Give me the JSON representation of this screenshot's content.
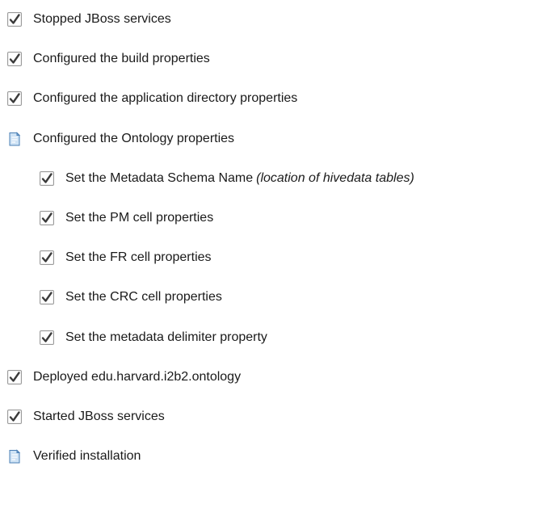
{
  "checklist": [
    {
      "level": 0,
      "status": "done",
      "icon": "checked-checkbox-icon",
      "label": "Stopped JBoss services",
      "note": ""
    },
    {
      "level": 0,
      "status": "done",
      "icon": "checked-checkbox-icon",
      "label": "Configured the build properties",
      "note": ""
    },
    {
      "level": 0,
      "status": "done",
      "icon": "checked-checkbox-icon",
      "label": "Configured the application directory properties",
      "note": ""
    },
    {
      "level": 0,
      "status": "pending",
      "icon": "document-icon",
      "label": "Configured the Ontology properties",
      "note": ""
    },
    {
      "level": 1,
      "status": "done",
      "icon": "checked-checkbox-icon",
      "label": "Set the Metadata Schema Name",
      "note": "(location of hivedata tables)"
    },
    {
      "level": 1,
      "status": "done",
      "icon": "checked-checkbox-icon",
      "label": "Set the PM cell properties",
      "note": ""
    },
    {
      "level": 1,
      "status": "done",
      "icon": "checked-checkbox-icon",
      "label": "Set the FR cell properties",
      "note": ""
    },
    {
      "level": 1,
      "status": "done",
      "icon": "checked-checkbox-icon",
      "label": "Set the CRC cell properties",
      "note": ""
    },
    {
      "level": 1,
      "status": "done",
      "icon": "checked-checkbox-icon",
      "label": "Set the metadata delimiter property",
      "note": ""
    },
    {
      "level": 0,
      "status": "done",
      "icon": "checked-checkbox-icon",
      "label": "Deployed edu.harvard.i2b2.ontology",
      "note": ""
    },
    {
      "level": 0,
      "status": "done",
      "icon": "checked-checkbox-icon",
      "label": "Started JBoss services",
      "note": ""
    },
    {
      "level": 0,
      "status": "pending",
      "icon": "document-icon",
      "label": "Verified installation",
      "note": ""
    }
  ]
}
